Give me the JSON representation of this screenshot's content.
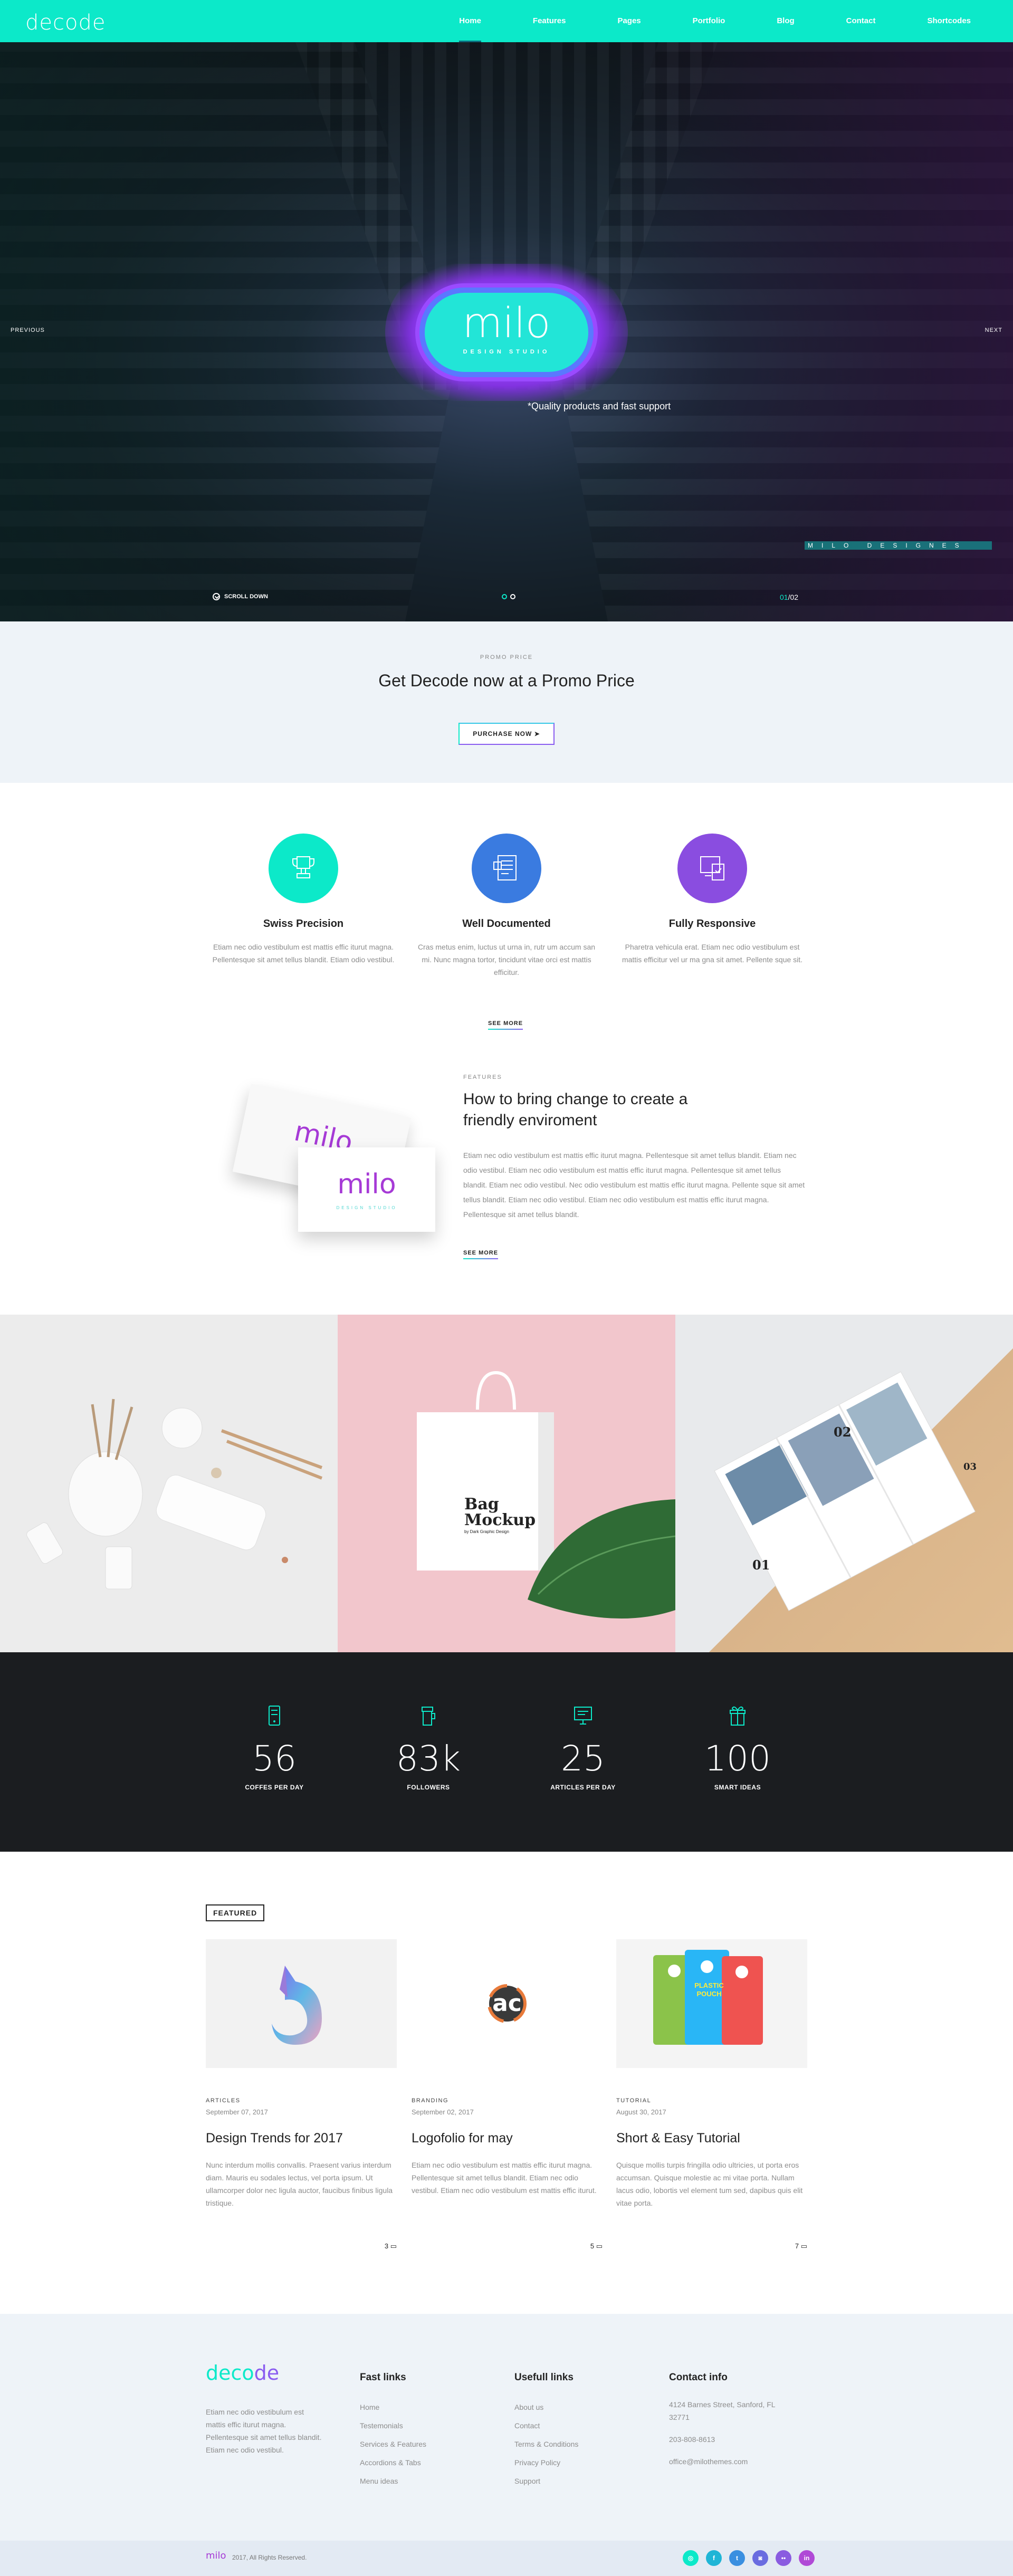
{
  "header": {
    "logo": "decode",
    "nav": [
      "Home",
      "Features",
      "Pages",
      "Portfolio",
      "Blog",
      "Contact",
      "Shortcodes"
    ],
    "active_nav": "Home"
  },
  "hero": {
    "brand": "milo",
    "brand_sub": "DESIGN STUDIO",
    "tagline": "*Quality products and fast support",
    "prev_label": "PREVIOUS",
    "next_label": "NEXT",
    "designs_label": "MILO DESIGNES",
    "scroll_label": "SCROLL DOWN",
    "slide_current": "01",
    "slide_total": "/02"
  },
  "promo": {
    "label": "PROMO PRICE",
    "title": "Get Decode now at a Promo Price",
    "button": "PURCHASE NOW"
  },
  "features": [
    {
      "title": "Swiss Precision",
      "text": "Etiam nec odio vestibulum est mattis effic iturut magna. Pellentesque sit amet tellus blandit. Etiam odio vestibul.",
      "icon": "trophy-icon",
      "color": "#0ce9c9"
    },
    {
      "title": "Well Documented",
      "text": "Cras metus enim, luctus ut urna in, rutr um accum san mi. Nunc magna tortor, tincidunt vitae orci est mattis efficitur.",
      "icon": "document-icon",
      "color": "#3a7be0"
    },
    {
      "title": "Fully Responsive",
      "text": "Pharetra vehicula erat. Etiam nec odio vestibulum est mattis efficitur vel ur ma gna sit amet. Pellente sque sit.",
      "icon": "devices-icon",
      "color": "#8a4de0"
    }
  ],
  "features_see_more": "SEE MORE",
  "about": {
    "label": "FEATURES",
    "title": "How to bring change to create a friendly enviroment",
    "text": "Etiam nec odio vestibulum est mattis effic iturut magna. Pellentesque sit amet tellus blandit. Etiam nec odio vestibul. Etiam nec odio vestibulum est mattis effic iturut magna. Pellentesque sit amet tellus blandit. Etiam nec odio vestibul. Nec odio vestibulum est mattis effic iturut magna. Pellente sque sit amet tellus blandit. Etiam nec odio vestibul. Etiam nec odio vestibulum est mattis effic iturut magna. Pellentesque sit amet tellus blandit.",
    "see_more": "SEE MORE",
    "card_logo": "milo",
    "card_sub": "DESIGN STUDIO"
  },
  "gallery": {
    "bag_line1": "Bag",
    "bag_line2": "Mockup",
    "bag_line3": "by Dark Graphic Design",
    "brochure_num1": "01",
    "brochure_num2": "02",
    "brochure_num3": "03"
  },
  "stats": [
    {
      "value": "56",
      "label": "COFFES PER DAY",
      "icon": "phone-icon"
    },
    {
      "value": "83k",
      "label": "FOLLOWERS",
      "icon": "coffee-cup-icon"
    },
    {
      "value": "25",
      "label": "ARTICLES PER DAY",
      "icon": "monitor-icon"
    },
    {
      "value": "100",
      "label": "SMART IDEAS",
      "icon": "gift-icon"
    }
  ],
  "blog": {
    "tag": "FEATURED",
    "posts": [
      {
        "category": "ARTICLES",
        "date": "September 07, 2017",
        "title": "Design Trends for 2017",
        "text": "Nunc interdum mollis convallis. Praesent varius interdum diam. Mauris eu sodales lectus, vel porta ipsum. Ut ullamcorper dolor nec ligula auctor, faucibus finibus ligula tristique.",
        "comments": "3"
      },
      {
        "category": "BRANDING",
        "date": "September 02, 2017",
        "title": "Logofolio for may",
        "text": "Etiam nec odio vestibulum est mattis effic iturut magna. Pellentesque sit amet tellus blandit. Etiam nec odio vestibul. Etiam nec odio vestibulum est mattis effic iturut.",
        "comments": "5",
        "img_text": "ac"
      },
      {
        "category": "TUTORIAL",
        "date": "August 30, 2017",
        "title": "Short & Easy Tutorial",
        "text": "Quisque mollis turpis fringilla odio ultricies, ut porta eros accumsan. Quisque molestie ac mi vitae porta. Nullam lacus odio, lobortis vel element tum sed, dapibus quis elit vitae porta.",
        "comments": "7",
        "pouch_line1": "PLASTIC",
        "pouch_line2": "POUCH"
      }
    ]
  },
  "footer": {
    "logo_a": "deco",
    "logo_b": "de",
    "about": "Etiam nec odio vestibulum est mattis effic iturut magna. Pellentesque sit amet tellus blandit. Etiam nec odio vestibul.",
    "fast_links_title": "Fast links",
    "fast_links": [
      "Home",
      "Testemonials",
      "Services & Features",
      "Accordions & Tabs",
      "Menu ideas"
    ],
    "useful_links_title": "Usefull links",
    "useful_links": [
      "About us",
      "Contact",
      "Terms & Conditions",
      "Privacy Policy",
      "Support"
    ],
    "contact_title": "Contact info",
    "address": "4124 Barnes Street, Sanford, FL 32771",
    "phone": "203-808-8613",
    "email": "office@milothemes.com",
    "bottom_logo": "milo",
    "copyright": "2017, All Rights Reserved.",
    "socials": [
      {
        "name": "tripadvisor-icon",
        "glyph": "◎",
        "color": "#0ce9c9"
      },
      {
        "name": "facebook-icon",
        "glyph": "f",
        "color": "#1fb5d6"
      },
      {
        "name": "twitter-icon",
        "glyph": "t",
        "color": "#3a8fe0"
      },
      {
        "name": "instagram-icon",
        "glyph": "◙",
        "color": "#6a6ce0"
      },
      {
        "name": "flickr-icon",
        "glyph": "••",
        "color": "#8a5ce0"
      },
      {
        "name": "linkedin-icon",
        "glyph": "in",
        "color": "#b04ad6"
      }
    ]
  }
}
